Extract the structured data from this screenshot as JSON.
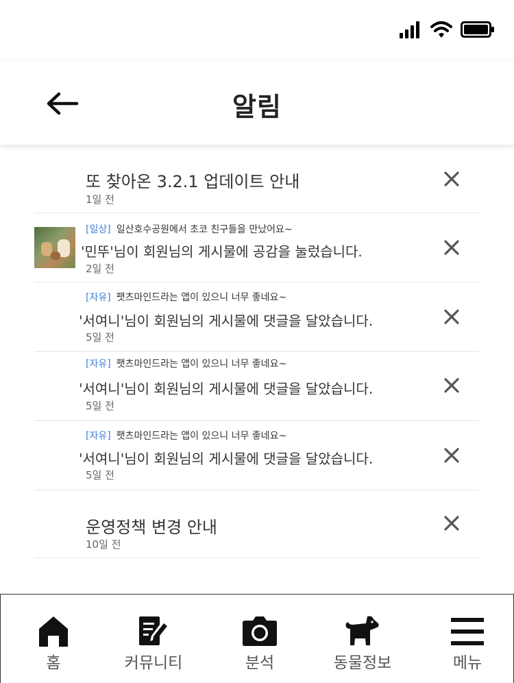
{
  "header": {
    "title": "알림"
  },
  "notifications": [
    {
      "message": "또 찾아온 3.2.1 업데이트 안내",
      "time": "1일 전"
    },
    {
      "tag": "[일상]",
      "post_title": "일산호수공원에서 초코 친구들을 만났어요~",
      "message": "'민뚜'님이 회원님의 게시물에 공감을 눌렀습니다.",
      "time": "2일 전"
    },
    {
      "tag": "[자유]",
      "post_title": "팻츠마인드라는 앱이 있으니 너무 좋네요~",
      "message": "'서여니'님이 회원님의 게시물에 댓글을 달았습니다.",
      "time": "5일 전"
    },
    {
      "tag": "[자유]",
      "post_title": "팻츠마인드라는 앱이 있으니 너무 좋네요~",
      "message": "'서여니'님이 회원님의 게시물에 댓글을 달았습니다.",
      "time": "5일 전"
    },
    {
      "tag": "[자유]",
      "post_title": "팻츠마인드라는 앱이 있으니 너무 좋네요~",
      "message": "'서여니'님이 회원님의 게시물에 댓글을 달았습니다.",
      "time": "5일 전"
    },
    {
      "message": "운영정책 변경 안내",
      "time": "10일 전"
    }
  ],
  "tabbar": {
    "home": "홈",
    "community": "커뮤니티",
    "analysis": "분석",
    "animal_info": "동물정보",
    "menu": "메뉴"
  },
  "icons": {
    "signal": "signal-icon",
    "wifi": "wifi-icon",
    "battery": "battery-icon",
    "back": "arrow-left-icon",
    "close": "close-icon",
    "home": "home-icon",
    "community": "edit-document-icon",
    "analysis": "camera-icon",
    "animal_info": "dog-icon",
    "menu": "hamburger-menu-icon"
  },
  "colors": {
    "tag": "#3d7fd6",
    "text": "#333333",
    "icon": "#111111"
  }
}
